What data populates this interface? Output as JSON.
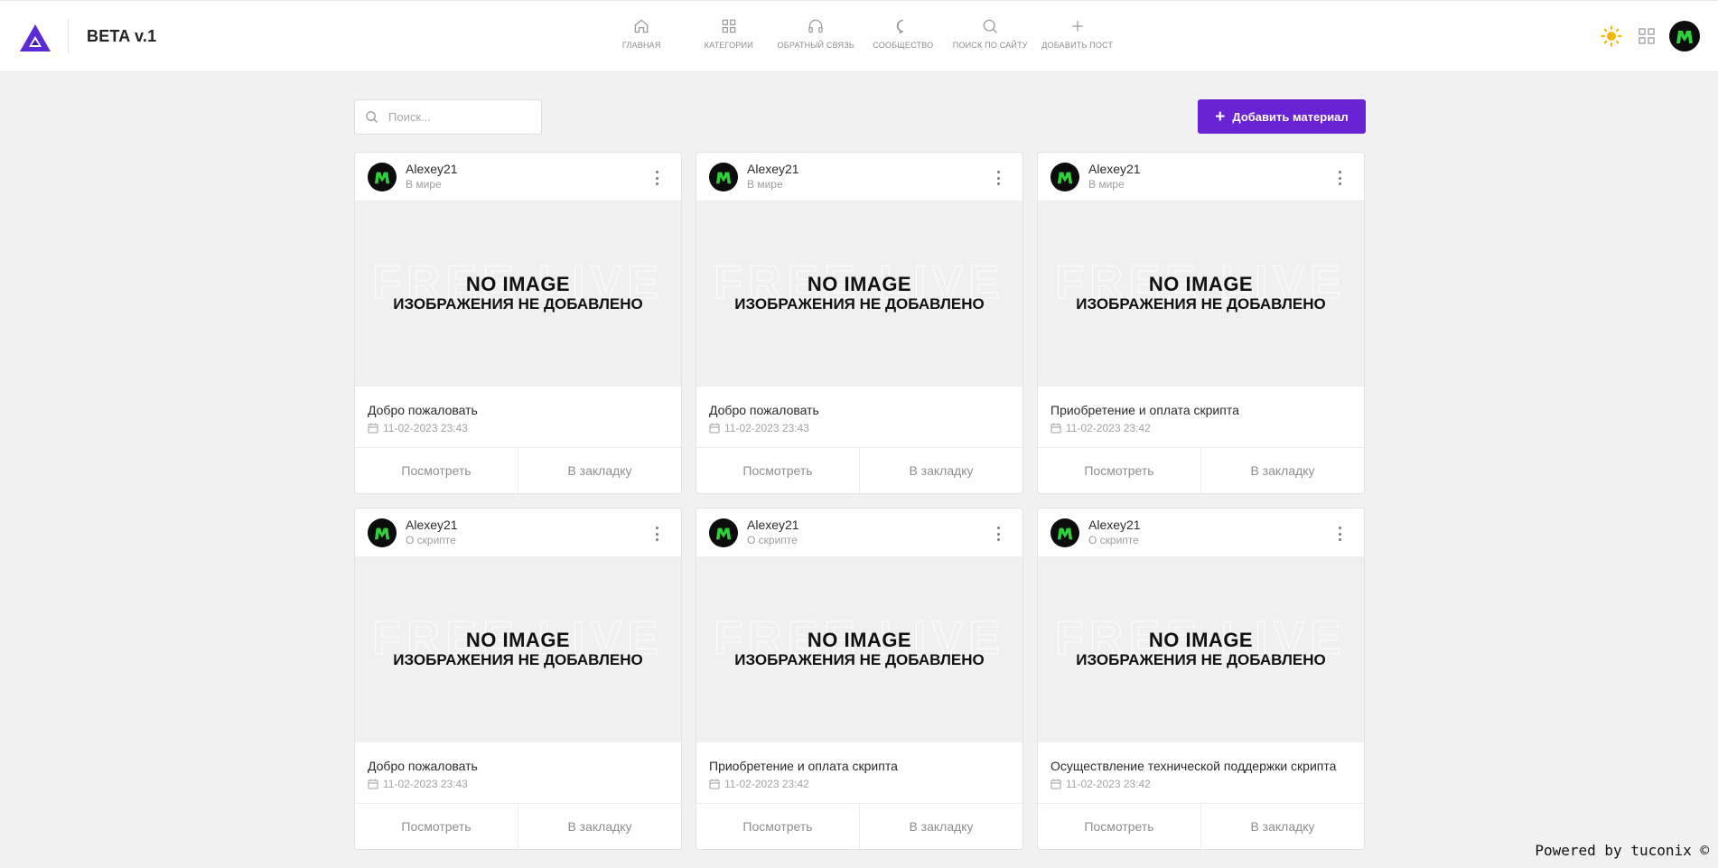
{
  "header": {
    "brand": "BETA v.1",
    "nav": [
      {
        "label": "Главная",
        "icon": "home-icon"
      },
      {
        "label": "Категории",
        "icon": "grid-icon"
      },
      {
        "label": "Обратный связь",
        "icon": "headphones-icon"
      },
      {
        "label": "Сообщество",
        "icon": "chat-icon"
      },
      {
        "label": "Поиск по сайту",
        "icon": "search-icon"
      },
      {
        "label": "Добавить пост",
        "icon": "plus-icon"
      }
    ],
    "accent_color": "#6a23d4",
    "theme_icon_color": "#f5b800"
  },
  "toolbar": {
    "search_placeholder": "Поиск...",
    "add_label": "Добавить материал"
  },
  "placeholder_image": {
    "line1": "NO IMAGE",
    "line2": "ИЗОБРАЖЕНИЯ НЕ ДОБАВЛЕНО"
  },
  "cards": [
    {
      "author": "Alexey21",
      "category": "В мире",
      "title": "Добро пожаловать",
      "date": "11-02-2023 23:43",
      "view": "Посмотреть",
      "bookmark": "В закладку"
    },
    {
      "author": "Alexey21",
      "category": "В мире",
      "title": "Добро пожаловать",
      "date": "11-02-2023 23:43",
      "view": "Посмотреть",
      "bookmark": "В закладку"
    },
    {
      "author": "Alexey21",
      "category": "В мире",
      "title": "Приобретение и оплата скрипта",
      "date": "11-02-2023 23:42",
      "view": "Посмотреть",
      "bookmark": "В закладку"
    },
    {
      "author": "Alexey21",
      "category": "О скрипте",
      "title": "Добро пожаловать",
      "date": "11-02-2023 23:43",
      "view": "Посмотреть",
      "bookmark": "В закладку"
    },
    {
      "author": "Alexey21",
      "category": "О скрипте",
      "title": "Приобретение и оплата скрипта",
      "date": "11-02-2023 23:42",
      "view": "Посмотреть",
      "bookmark": "В закладку"
    },
    {
      "author": "Alexey21",
      "category": "О скрипте",
      "title": "Осуществление технической поддержки скрипта",
      "date": "11-02-2023 23:42",
      "view": "Посмотреть",
      "bookmark": "В закладку"
    }
  ],
  "footer": {
    "powered": "Powered by tuconix ©"
  }
}
